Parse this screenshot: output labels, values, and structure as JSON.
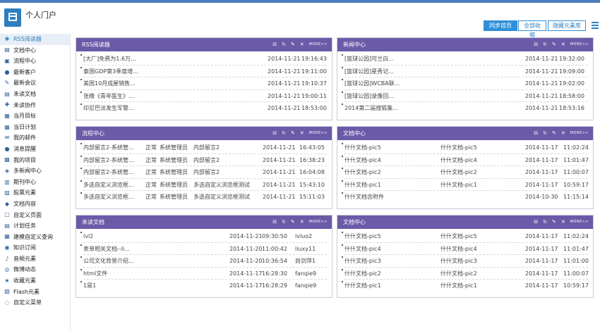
{
  "header": {
    "title": "个人门户",
    "btn_sync": "同步首页",
    "btn_collapse": "全部收缩",
    "btn_hide": "隐藏元素库"
  },
  "sidebar": {
    "items": [
      {
        "label": "RSS阅读器",
        "icon": "rss-icon"
      },
      {
        "label": "文档中心",
        "icon": "document-icon"
      },
      {
        "label": "流程中心",
        "icon": "flow-icon"
      },
      {
        "label": "最新客户",
        "icon": "user-icon"
      },
      {
        "label": "最新会议",
        "icon": "pencil-icon"
      },
      {
        "label": "未读文档",
        "icon": "document-icon"
      },
      {
        "label": "未读协作",
        "icon": "collab-icon"
      },
      {
        "label": "当月目标",
        "icon": "calendar-icon"
      },
      {
        "label": "当日计划",
        "icon": "calendar-icon"
      },
      {
        "label": "我的邮件",
        "icon": "mail-icon"
      },
      {
        "label": "消息提醒",
        "icon": "message-icon"
      },
      {
        "label": "我的项目",
        "icon": "project-icon"
      },
      {
        "label": "多新闻中心",
        "icon": "news-icon"
      },
      {
        "label": "期刊中心",
        "icon": "journal-icon"
      },
      {
        "label": "股票元素",
        "icon": "stock-icon"
      },
      {
        "label": "文档内容",
        "icon": "tag-icon"
      },
      {
        "label": "自定义页面",
        "icon": "page-icon"
      },
      {
        "label": "计划任务",
        "icon": "task-icon"
      },
      {
        "label": "建模自定义查询",
        "icon": "query-icon"
      },
      {
        "label": "知识订阅",
        "icon": "subscribe-icon"
      },
      {
        "label": "音频元素",
        "icon": "music-icon"
      },
      {
        "label": "微博动态",
        "icon": "weibo-icon"
      },
      {
        "label": "收藏元素",
        "icon": "star-icon"
      },
      {
        "label": "Flash元素",
        "icon": "flash-icon"
      },
      {
        "label": "自定义菜单",
        "icon": "menu-icon"
      }
    ]
  },
  "panel_tools": {
    "more": "MORE>>"
  },
  "panels": [
    {
      "title": "RSS阅读器",
      "rows": [
        [
          "[大厂]免费为1.6万...",
          "2014-11-21",
          "19:16:43"
        ],
        [
          "泰国GDP第3季度增...",
          "2014-11-21",
          "19:11:00"
        ],
        [
          "美国10月成屋销售...",
          "2014-11-21",
          "19:10:37"
        ],
        [
          "张橹《青年医生》...",
          "2014-11-21",
          "19:00:11"
        ],
        [
          "印尼巴淡发生军警...",
          "2014-11-21",
          "18:53:00"
        ]
      ]
    },
    {
      "title": "新闻中心",
      "rows": [
        [
          "[篮球公园]可兰白...",
          "2014-11-21",
          "19:32:00"
        ],
        [
          "[篮球公园]星秀记...",
          "2014-11-21",
          "19:09:00"
        ],
        [
          "[篮球公园]WCBA联...",
          "2014-11-21",
          "19:02:00"
        ],
        [
          "[篮球公园]录像回...",
          "2014-11-21",
          "18:58:00"
        ],
        [
          "2014第二届搜狐集...",
          "2014-11-21",
          "18:53:16"
        ]
      ]
    },
    {
      "title": "流程中心",
      "rows": [
        [
          "内部留言2-系统管...",
          "正常",
          "系统管理员",
          "内部留言2",
          "2014-11-21",
          "16:43:05"
        ],
        [
          "内部留言2-系统管...",
          "正常",
          "系统管理员",
          "内部留言2",
          "2014-11-21",
          "16:38:23"
        ],
        [
          "内部留言2-系统管...",
          "正常",
          "系统管理员",
          "内部留言2",
          "2014-11-21",
          "16:04:08"
        ],
        [
          "多选自定义浏览框...",
          "正常",
          "系统管理员",
          "多选自定义浏览框测试",
          "2014-11-21",
          "15:43:10"
        ],
        [
          "多选自定义浏览框...",
          "正常",
          "系统管理员",
          "多选自定义浏览框测试",
          "2014-11-21",
          "15:11:03"
        ]
      ]
    },
    {
      "title": "文档中心",
      "rows": [
        [
          "什什文档-pic5",
          "什什文档-pic5",
          "2014-11-17",
          "11:02:24"
        ],
        [
          "什什文档-pic4",
          "什什文档-pic4",
          "2014-11-17",
          "11:01:47"
        ],
        [
          "什什文档-pic2",
          "什什文档-pic2",
          "2014-11-17",
          "11:00:07"
        ],
        [
          "什什文档-pic1",
          "什什文档-pic1",
          "2014-11-17",
          "10:59:17"
        ],
        [
          "什什文档含附件",
          "",
          "2014-10-30",
          "11:15:14"
        ]
      ]
    },
    {
      "title": "未读文档",
      "rows": [
        [
          "lvl2",
          "2014-11-21",
          "09:30:50",
          "lvluo2"
        ],
        [
          "表单相关文档--li...",
          "2014-11-20",
          "11:00:42",
          "liuxy11"
        ],
        [
          "公司文化背景介绍...",
          "2014-11-20",
          "10:36:54",
          "尚剑萍1"
        ],
        [
          "html文件",
          "2014-11-17",
          "16:28:30",
          "fanqie9"
        ],
        [
          "1是1",
          "2014-11-17",
          "16:28:29",
          "fanqie9"
        ]
      ]
    },
    {
      "title": "文档中心",
      "rows": [
        [
          "什什文档-pic5",
          "什什文档-pic5",
          "2014-11-17",
          "11:02:24"
        ],
        [
          "什什文档-pic4",
          "什什文档-pic4",
          "2014-11-17",
          "11:01:47"
        ],
        [
          "什什文档-pic3",
          "什什文档-pic3",
          "2014-11-17",
          "11:01:00"
        ],
        [
          "什什文档-pic2",
          "什什文档-pic2",
          "2014-11-17",
          "11:00:07"
        ],
        [
          "什什文档-pic1",
          "什什文档-pic1",
          "2014-11-17",
          "10:59:17"
        ]
      ]
    }
  ],
  "colors": {
    "panel_header": "#6a5aa8",
    "accent": "#2e8fd8"
  }
}
